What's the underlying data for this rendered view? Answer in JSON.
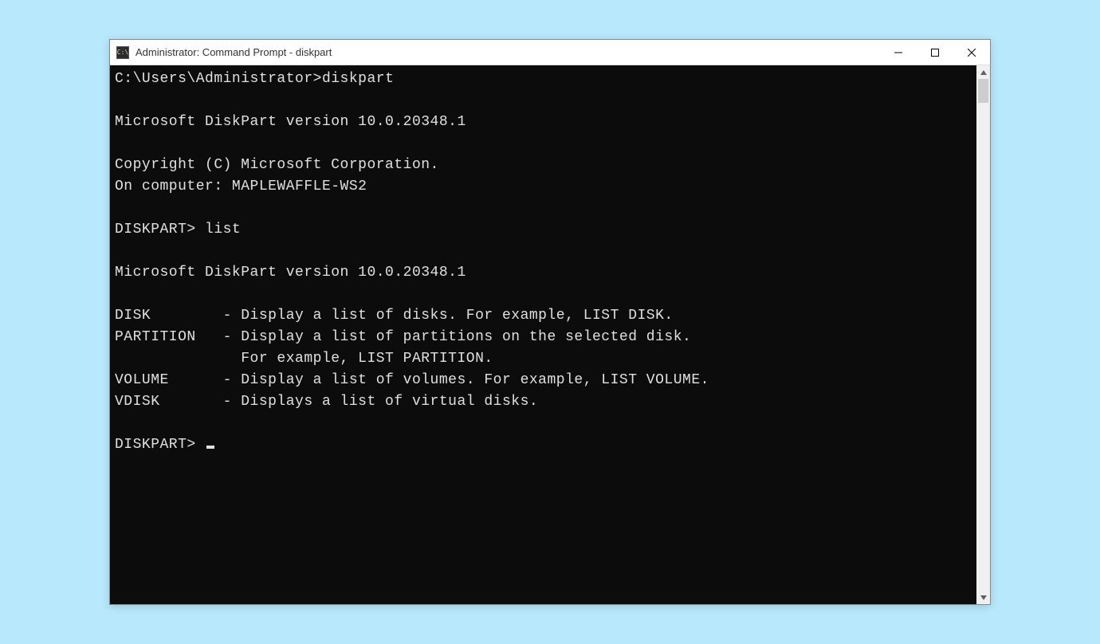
{
  "window": {
    "title": "Administrator: Command Prompt - diskpart",
    "icon_label": "C:\\"
  },
  "terminal": {
    "line1_prompt": "C:\\Users\\Administrator>",
    "line1_cmd": "diskpart",
    "blank1": "",
    "version1": "Microsoft DiskPart version 10.0.20348.1",
    "blank2": "",
    "copyright": "Copyright (C) Microsoft Corporation.",
    "computer": "On computer: MAPLEWAFFLE-WS2",
    "blank3": "",
    "prompt2": "DISKPART> list",
    "blank4": "",
    "version2": "Microsoft DiskPart version 10.0.20348.1",
    "blank5": "",
    "disk": "DISK        - Display a list of disks. For example, LIST DISK.",
    "partition": "PARTITION   - Display a list of partitions on the selected disk.",
    "partition2": "              For example, LIST PARTITION.",
    "volume": "VOLUME      - Display a list of volumes. For example, LIST VOLUME.",
    "vdisk": "VDISK       - Displays a list of virtual disks.",
    "blank6": "",
    "prompt3": "DISKPART> "
  }
}
